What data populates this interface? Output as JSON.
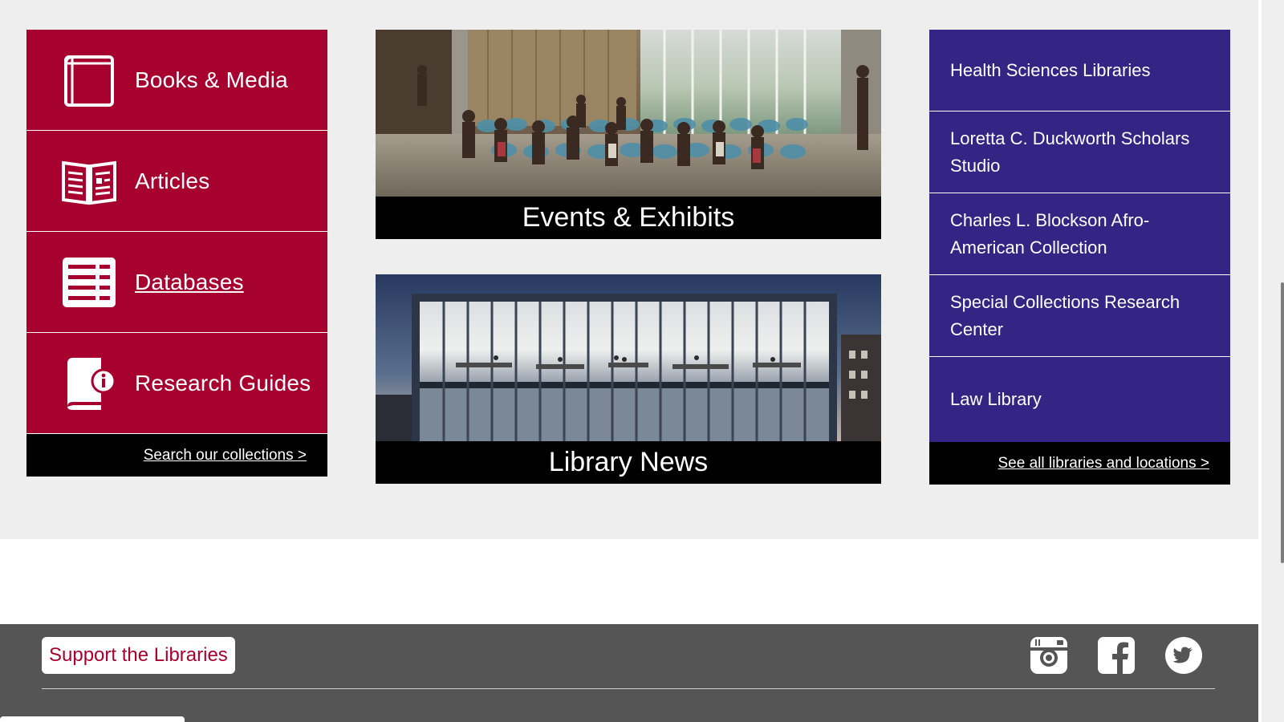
{
  "collections": {
    "items": [
      {
        "label": "Books & Media",
        "icon": "book-icon"
      },
      {
        "label": "Articles",
        "icon": "newspaper-icon"
      },
      {
        "label": "Databases",
        "icon": "database-icon"
      },
      {
        "label": "Research Guides",
        "icon": "guide-book-icon"
      }
    ],
    "footer_link": "Search our collections >"
  },
  "cards": [
    {
      "caption": "Events & Exhibits"
    },
    {
      "caption": "Library News"
    }
  ],
  "libraries": {
    "items": [
      "Health Sciences Libraries",
      "Loretta C. Duckworth Scholars Studio",
      "Charles L. Blockson Afro-American Collection",
      "Special Collections Research Center",
      "Law Library"
    ],
    "footer_link": "See all libraries and locations >"
  },
  "footer": {
    "support_label": "Support the Libraries",
    "social": [
      "instagram-icon",
      "facebook-icon",
      "twitter-icon"
    ]
  },
  "colors": {
    "cherry": "#a6012f",
    "purple": "#342483",
    "footer_gray": "#555555",
    "band_gray": "#eeeeee"
  }
}
